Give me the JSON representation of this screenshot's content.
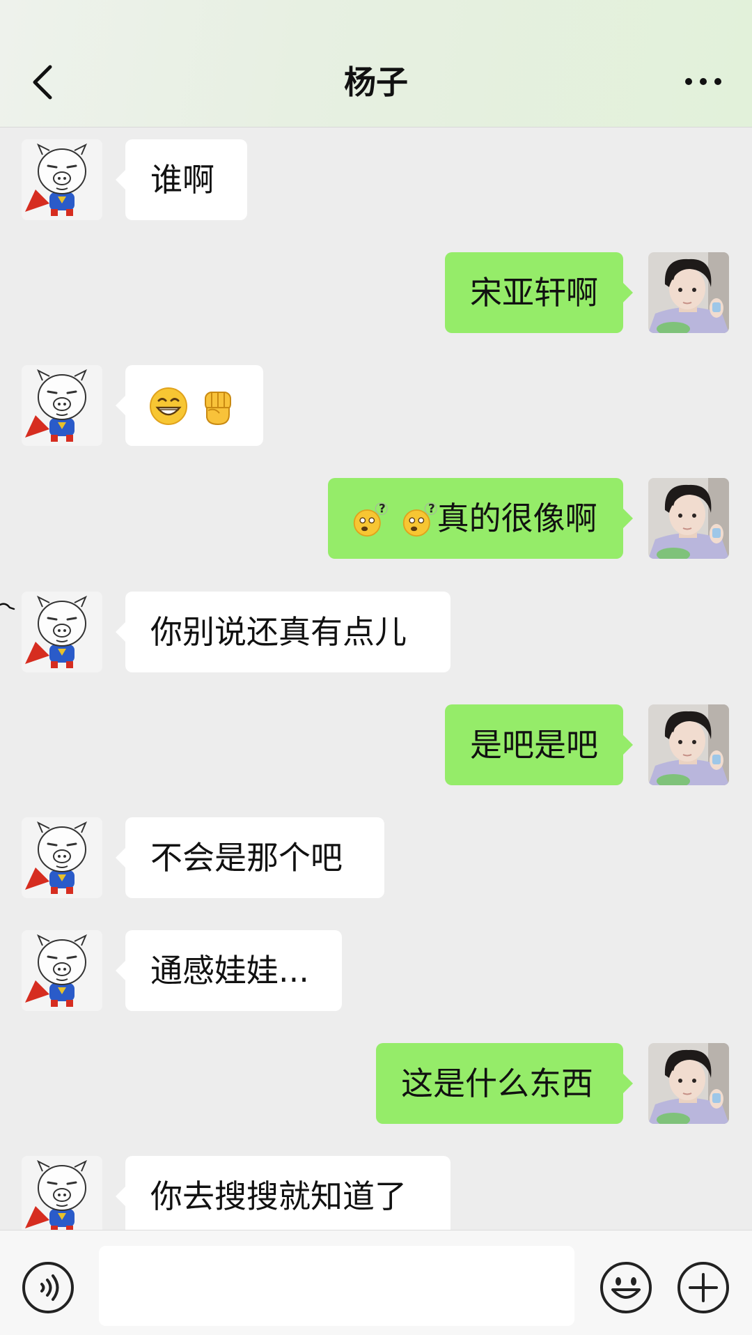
{
  "header": {
    "title": "杨子",
    "back_icon": "chevron-left-icon",
    "more_icon": "more-dots-icon"
  },
  "colors": {
    "sent_bubble": "#95ec69",
    "received_bubble": "#ffffff",
    "background": "#ededed"
  },
  "messages": [
    {
      "side": "left",
      "text": "谁啊"
    },
    {
      "side": "right",
      "text": "宋亚轩啊"
    },
    {
      "side": "left",
      "text": "",
      "emojis": [
        "grinning-face-icon",
        "raised-fist-icon"
      ]
    },
    {
      "side": "right",
      "text": "真的很像啊",
      "emojis": [
        "confused-face-question-icon",
        "confused-face-question-icon"
      ]
    },
    {
      "side": "left",
      "text": "你别说还真有点儿"
    },
    {
      "side": "right",
      "text": "是吧是吧"
    },
    {
      "side": "left",
      "text": "不会是那个吧"
    },
    {
      "side": "left",
      "text": "通感娃娃..."
    },
    {
      "side": "right",
      "text": "这是什么东西"
    },
    {
      "side": "left",
      "text": "你去搜搜就知道了"
    }
  ],
  "input_bar": {
    "voice_icon": "voice-icon",
    "message_value": "",
    "emoji_icon": "emoji-icon",
    "plus_icon": "plus-icon"
  }
}
